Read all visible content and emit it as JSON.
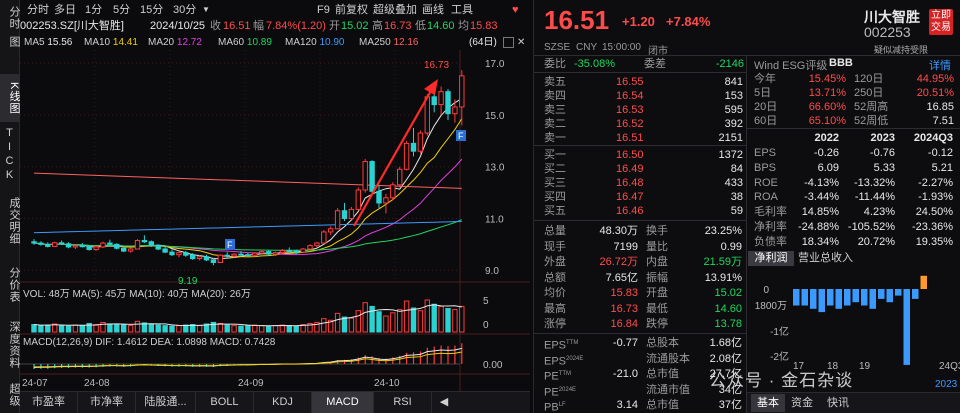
{
  "sidebar": {
    "tabs": [
      {
        "label": "分时",
        "active": false
      },
      {
        "label": "图",
        "active": false
      },
      {
        "label": "K线图",
        "active": true
      },
      {
        "label": "TICK",
        "active": false
      },
      {
        "label": "成交明细",
        "active": false
      },
      {
        "label": "分价表",
        "active": false
      },
      {
        "label": "深度资料",
        "active": false
      },
      {
        "label": "超级",
        "active": false
      }
    ]
  },
  "toolbar": {
    "periods": [
      "分时",
      "多日",
      "1分",
      "5分",
      "15分",
      "30分"
    ],
    "more": "▼",
    "f9": "F9",
    "adjust": "前复权",
    "overlay": "超级叠加",
    "draw": "画线",
    "tools": "工具",
    "fav": "♥"
  },
  "info": {
    "code_name": "002253.SZ[川大智胜]",
    "date": "2024/10/25",
    "close_label": "收",
    "close": "16.51",
    "change_label": "幅",
    "change": "7.84%(1.20)",
    "open_label": "开",
    "open": "15.02",
    "high_label": "高",
    "high": "16.73",
    "low_label": "低",
    "low": "14.60",
    "avg_label": "均",
    "avg": "15.83"
  },
  "ma": {
    "items": [
      {
        "label": "MA5",
        "value": "15.56",
        "color": "#e8e8e8"
      },
      {
        "label": "MA10",
        "value": "14.41",
        "color": "#f0d000"
      },
      {
        "label": "MA20",
        "value": "12.72",
        "color": "#e040e0"
      },
      {
        "label": "MA60",
        "value": "10.89",
        "color": "#1ed760"
      },
      {
        "label": "MA120",
        "value": "10.90",
        "color": "#3a9aff"
      },
      {
        "label": "MA250",
        "value": "12.16",
        "color": "#ff6060"
      }
    ],
    "right_label": "(64日)"
  },
  "chart_data": {
    "type": "candlestick",
    "y_ticks": [
      "17.0",
      "15.0",
      "13.0",
      "11.0",
      "9.0"
    ],
    "ylim": [
      8.7,
      17.2
    ],
    "x_ticks": [
      "24-07",
      "24-08",
      "24-09",
      "24-10"
    ],
    "high_label": "16.73",
    "low_label": "9.19",
    "marker_f": "F",
    "vol_text": "VOL: 48万  MA(5): 45万  MA(10): 40万  MA(20): 26万",
    "vol_ticks": [
      "5",
      "0"
    ],
    "macd_text": "MACD(12,26,9)  DIF: 1.4612  DEA: 1.0898  MACD: 0.7428",
    "macd_ticks": [
      "0.00"
    ],
    "candles": [
      [
        10.1,
        10.2,
        9.98,
        10.05
      ],
      [
        10.05,
        10.12,
        9.95,
        10.0
      ],
      [
        10.0,
        10.08,
        9.88,
        9.92
      ],
      [
        9.92,
        10.1,
        9.9,
        10.06
      ],
      [
        10.06,
        10.15,
        9.98,
        10.02
      ],
      [
        10.02,
        10.08,
        9.85,
        9.9
      ],
      [
        9.9,
        10.0,
        9.82,
        9.95
      ],
      [
        9.95,
        10.05,
        9.88,
        9.92
      ],
      [
        9.92,
        9.98,
        9.76,
        9.8
      ],
      [
        9.8,
        9.95,
        9.75,
        9.9
      ],
      [
        9.9,
        10.1,
        9.86,
        10.05
      ],
      [
        10.05,
        10.18,
        9.98,
        10.0
      ],
      [
        10.0,
        10.04,
        9.8,
        9.85
      ],
      [
        9.85,
        9.92,
        9.7,
        9.74
      ],
      [
        9.74,
        9.86,
        9.68,
        9.82
      ],
      [
        9.82,
        10.2,
        9.8,
        10.15
      ],
      [
        10.15,
        10.35,
        10.05,
        10.1
      ],
      [
        10.1,
        10.15,
        9.9,
        9.95
      ],
      [
        9.95,
        10.0,
        9.78,
        9.82
      ],
      [
        9.82,
        9.9,
        9.66,
        9.7
      ],
      [
        9.7,
        9.8,
        9.55,
        9.6
      ],
      [
        9.6,
        9.72,
        9.5,
        9.68
      ],
      [
        9.68,
        9.75,
        9.52,
        9.58
      ],
      [
        9.58,
        9.66,
        9.4,
        9.45
      ],
      [
        9.45,
        9.58,
        9.38,
        9.52
      ],
      [
        9.52,
        9.6,
        9.35,
        9.4
      ],
      [
        9.4,
        9.48,
        9.19,
        9.3
      ],
      [
        9.3,
        9.62,
        9.28,
        9.58
      ],
      [
        9.58,
        9.7,
        9.5,
        9.55
      ],
      [
        9.55,
        9.66,
        9.48,
        9.62
      ],
      [
        9.62,
        9.74,
        9.56,
        9.6
      ],
      [
        9.6,
        9.68,
        9.5,
        9.58
      ],
      [
        9.58,
        9.7,
        9.52,
        9.66
      ],
      [
        9.66,
        9.8,
        9.6,
        9.72
      ],
      [
        9.72,
        9.78,
        9.58,
        9.62
      ],
      [
        9.62,
        9.72,
        9.55,
        9.68
      ],
      [
        9.68,
        9.82,
        9.62,
        9.76
      ],
      [
        9.76,
        9.88,
        9.7,
        9.74
      ],
      [
        9.74,
        9.8,
        9.62,
        9.7
      ],
      [
        9.7,
        9.86,
        9.66,
        9.82
      ],
      [
        9.82,
        10.0,
        9.78,
        9.95
      ],
      [
        9.95,
        10.1,
        9.88,
        10.05
      ],
      [
        10.05,
        10.55,
        10.0,
        10.48
      ],
      [
        10.48,
        10.7,
        10.35,
        10.6
      ],
      [
        10.6,
        11.4,
        10.58,
        11.3
      ],
      [
        11.3,
        11.6,
        10.9,
        11.0
      ],
      [
        11.0,
        11.45,
        10.95,
        11.35
      ],
      [
        11.35,
        12.2,
        11.3,
        12.1
      ],
      [
        12.1,
        13.3,
        12.0,
        13.2
      ],
      [
        13.2,
        13.25,
        11.9,
        12.05
      ],
      [
        12.05,
        12.3,
        11.4,
        11.6
      ],
      [
        11.6,
        11.95,
        11.2,
        11.8
      ],
      [
        11.8,
        12.4,
        11.7,
        12.3
      ],
      [
        12.3,
        13.0,
        12.2,
        12.9
      ],
      [
        12.9,
        14.0,
        12.85,
        13.9
      ],
      [
        13.9,
        14.5,
        13.4,
        13.6
      ],
      [
        13.6,
        14.4,
        13.5,
        14.3
      ],
      [
        14.3,
        15.8,
        14.2,
        15.7
      ],
      [
        15.7,
        16.2,
        15.1,
        15.4
      ],
      [
        15.4,
        16.1,
        15.0,
        15.9
      ],
      [
        15.9,
        16.0,
        14.8,
        15.05
      ],
      [
        15.05,
        15.6,
        14.7,
        15.31
      ],
      [
        15.31,
        16.73,
        14.6,
        16.51
      ]
    ],
    "volumes": [
      14,
      12,
      13,
      15,
      12,
      11,
      13,
      12,
      16,
      14,
      18,
      15,
      13,
      14,
      12,
      20,
      17,
      14,
      13,
      12,
      11,
      12,
      13,
      14,
      12,
      15,
      18,
      16,
      13,
      12,
      11,
      12,
      13,
      12,
      11,
      12,
      13,
      12,
      11,
      14,
      16,
      18,
      25,
      22,
      35,
      28,
      26,
      40,
      55,
      48,
      38,
      30,
      36,
      42,
      58,
      45,
      40,
      60,
      52,
      48,
      44,
      42,
      48
    ],
    "macd": [
      -0.18,
      -0.17,
      -0.17,
      -0.15,
      -0.14,
      -0.14,
      -0.13,
      -0.13,
      -0.13,
      -0.12,
      -0.1,
      -0.09,
      -0.09,
      -0.1,
      -0.09,
      -0.06,
      -0.05,
      -0.06,
      -0.07,
      -0.08,
      -0.09,
      -0.09,
      -0.09,
      -0.1,
      -0.1,
      -0.1,
      -0.11,
      -0.08,
      -0.07,
      -0.06,
      -0.05,
      -0.05,
      -0.04,
      -0.03,
      -0.03,
      -0.02,
      -0.01,
      -0.01,
      -0.01,
      0.0,
      0.01,
      0.02,
      0.06,
      0.08,
      0.14,
      0.15,
      0.17,
      0.23,
      0.32,
      0.28,
      0.22,
      0.2,
      0.24,
      0.3,
      0.4,
      0.42,
      0.45,
      0.58,
      0.62,
      0.66,
      0.64,
      0.66,
      0.74
    ]
  },
  "bottom_tabs": [
    {
      "label": "市盈率",
      "active": false
    },
    {
      "label": "市净率",
      "active": false
    },
    {
      "label": "陆股通...",
      "active": false
    },
    {
      "label": "BOLL",
      "active": false
    },
    {
      "label": "KDJ",
      "active": false
    },
    {
      "label": "MACD",
      "active": true
    },
    {
      "label": "RSI",
      "active": false
    }
  ],
  "quote": {
    "price": "16.51",
    "change": "+1.20",
    "change_pct": "+7.84%",
    "name": "川大智胜",
    "code": "002253",
    "trade_btn": "立即交易",
    "exchange": "SZSE",
    "currency": "CNY",
    "time": "15:00:00",
    "status": "闭市",
    "note": "疑似减持受限",
    "webi_label": "委比",
    "webi": "-35.08%",
    "wecha_label": "委差",
    "wecha": "-2146",
    "asks": [
      {
        "label": "卖五",
        "price": "16.55",
        "vol": "841"
      },
      {
        "label": "卖四",
        "price": "16.54",
        "vol": "153"
      },
      {
        "label": "卖三",
        "price": "16.53",
        "vol": "595"
      },
      {
        "label": "卖二",
        "price": "16.52",
        "vol": "392"
      },
      {
        "label": "卖一",
        "price": "16.51",
        "vol": "2151"
      }
    ],
    "bids": [
      {
        "label": "买一",
        "price": "16.50",
        "vol": "1372"
      },
      {
        "label": "买二",
        "price": "16.49",
        "vol": "84"
      },
      {
        "label": "买三",
        "price": "16.48",
        "vol": "433"
      },
      {
        "label": "买四",
        "price": "16.47",
        "vol": "38"
      },
      {
        "label": "买五",
        "price": "16.46",
        "vol": "59"
      }
    ],
    "stats": [
      {
        "l1": "总量",
        "v1": "48.30万",
        "c1": "#e8e8e8",
        "l2": "换手",
        "v2": "23.25%",
        "c2": "#e8e8e8"
      },
      {
        "l1": "现手",
        "v1": "7199",
        "c1": "#e8e8e8",
        "l2": "量比",
        "v2": "0.99",
        "c2": "#e8e8e8"
      },
      {
        "l1": "外盘",
        "v1": "26.72万",
        "c1": "#ff4b4b",
        "l2": "内盘",
        "v2": "21.59万",
        "c2": "#1ed760"
      },
      {
        "l1": "总额",
        "v1": "7.65亿",
        "c1": "#e8e8e8",
        "l2": "振幅",
        "v2": "13.91%",
        "c2": "#e8e8e8"
      },
      {
        "l1": "均价",
        "v1": "15.83",
        "c1": "#ff4b4b",
        "l2": "开盘",
        "v2": "15.02",
        "c2": "#1ed760"
      },
      {
        "l1": "最高",
        "v1": "16.73",
        "c1": "#ff4b4b",
        "l2": "最低",
        "v2": "14.60",
        "c2": "#1ed760"
      },
      {
        "l1": "涨停",
        "v1": "16.84",
        "c1": "#ff4b4b",
        "l2": "跌停",
        "v2": "13.78",
        "c2": "#1ed760"
      }
    ],
    "fundamentals": [
      {
        "l1": "EPS",
        "sup1": "TTM",
        "v1": "-0.77",
        "l2": "总股本",
        "v2": "1.68亿"
      },
      {
        "l1": "EPS",
        "sup1": "2024E",
        "v1": "",
        "l2": "流通股本",
        "v2": "2.08亿"
      },
      {
        "l1": "PE",
        "sup1": "TTM",
        "v1": "-21.0",
        "l2": "总市值",
        "v2": "27.7亿"
      },
      {
        "l1": "PE",
        "sup1": "2024E",
        "v1": "",
        "l2": "流通市值",
        "v2": "34亿"
      },
      {
        "l1": "PB",
        "sup1": "LF",
        "v1": "3.14",
        "l2": "总市值",
        "v2": "37亿"
      }
    ]
  },
  "esg": {
    "label": "Wind ESG评级",
    "rating": "BBB",
    "detail": "详情",
    "perf": [
      {
        "l1": "今年",
        "v1": "15.45%",
        "l2": "120日",
        "v2": "44.95%",
        "c2": "#ff4b4b"
      },
      {
        "l1": "5日",
        "v1": "13.71%",
        "l2": "250日",
        "v2": "20.51%",
        "c2": "#ff4b4b"
      },
      {
        "l1": "20日",
        "v1": "66.60%",
        "l2": "52周高",
        "v2": "16.85",
        "c2": "#e8e8e8"
      },
      {
        "l1": "60日",
        "v1": "65.10%",
        "l2": "52周低",
        "v2": "7.51",
        "c2": "#e8e8e8"
      }
    ],
    "years": [
      "2022",
      "2023",
      "2024Q3"
    ],
    "metrics": [
      {
        "name": "EPS",
        "vals": [
          "-0.26",
          "-0.76",
          "-0.12"
        ]
      },
      {
        "name": "BPS",
        "vals": [
          "6.09",
          "5.33",
          "5.21"
        ]
      },
      {
        "name": "ROE",
        "vals": [
          "-4.13%",
          "-13.32%",
          "-2.27%"
        ]
      },
      {
        "name": "ROA",
        "vals": [
          "-3.44%",
          "-11.44%",
          "-1.93%"
        ]
      },
      {
        "name": "毛利率",
        "vals": [
          "14.85%",
          "4.23%",
          "24.50%"
        ]
      },
      {
        "name": "净利率",
        "vals": [
          "-24.88%",
          "-105.52%",
          "-23.36%"
        ]
      },
      {
        "name": "负债率",
        "vals": [
          "18.34%",
          "20.72%",
          "19.35%"
        ]
      }
    ],
    "tab_profit": "净利润",
    "tab_revenue": "营业总收入",
    "bar_ticks": [
      "0",
      "1800万",
      "-1亿",
      "-2亿"
    ],
    "bar_xlabels": [
      "17",
      "18",
      "19",
      "24Q3"
    ],
    "bar_year": "2023",
    "bar_values": [
      -0.05,
      -0.05,
      -0.06,
      -0.07,
      -0.05,
      -0.06,
      -0.05,
      -0.04,
      -0.05,
      -0.06,
      -0.03,
      -0.04,
      -0.02,
      -0.23,
      -0.03,
      0.04
    ]
  },
  "bottom_right_tabs": [
    {
      "label": "基本",
      "active": true
    },
    {
      "label": "资金",
      "active": false
    },
    {
      "label": "快讯",
      "active": false
    }
  ],
  "watermark": "公众号 · 金石杂谈"
}
